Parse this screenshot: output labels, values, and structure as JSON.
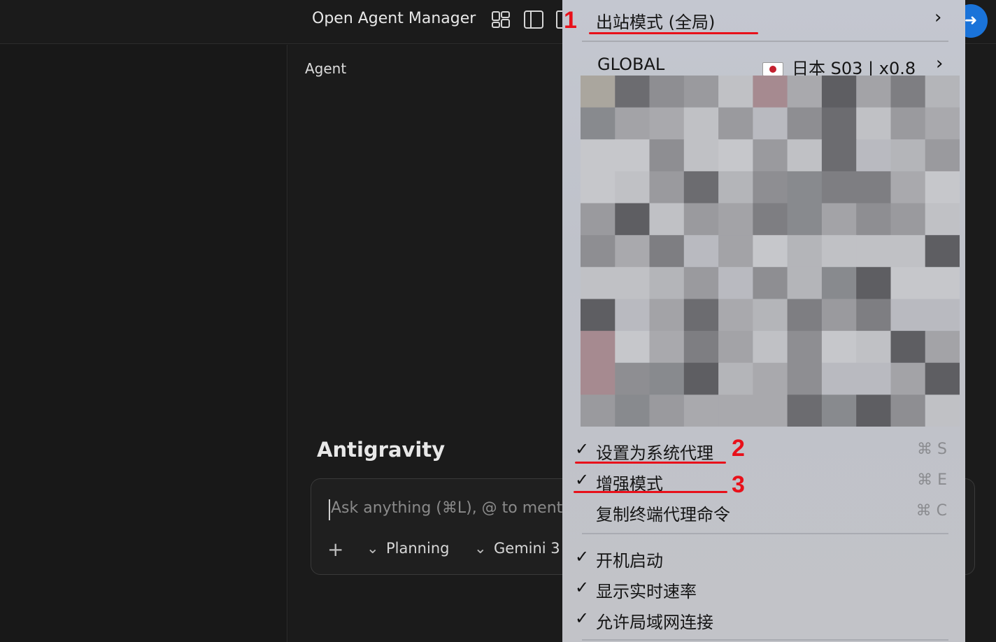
{
  "app": {
    "title": "Open Agent Manager",
    "agent_label": "Agent",
    "brand": "Antigravity"
  },
  "chat": {
    "placeholder": "Ask anything (⌘L), @ to ment",
    "mode_label": "Planning",
    "model_label": "Gemini 3",
    "add_icon": "plus-icon",
    "send_icon": "arrow-right-icon"
  },
  "menu": {
    "outbound_mode": "出站模式 (全局)",
    "proxy_group": "GLOBAL",
    "proxy_node": "日本 S03 | x0.8",
    "set_system_proxy": {
      "label": "设置为系统代理",
      "checked": true,
      "shortcut": "⌘ S"
    },
    "enhanced_mode": {
      "label": "增强模式",
      "checked": true,
      "shortcut": "⌘ E"
    },
    "copy_terminal": {
      "label": "复制终端代理命令",
      "checked": false,
      "shortcut": "⌘ C"
    },
    "launch_at_login": {
      "label": "开机启动",
      "checked": true
    },
    "show_speed": {
      "label": "显示实时速率",
      "checked": true
    },
    "allow_lan": {
      "label": "允许局域网连接",
      "checked": true
    },
    "check_mark": "✓",
    "chevron": "›"
  },
  "annotations": {
    "n1": "1",
    "n2": "2",
    "n3": "3",
    "color": "#e8101a"
  }
}
